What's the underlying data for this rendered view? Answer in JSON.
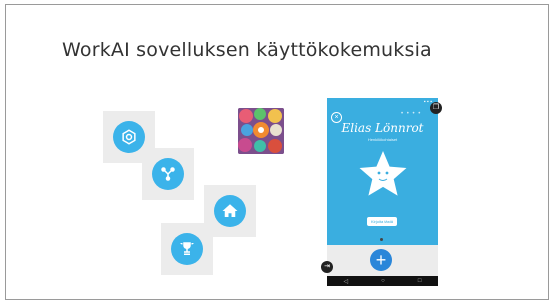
{
  "slide": {
    "title": "WorkAI sovelluksen käyttökokemuksia"
  },
  "icons": [
    {
      "name": "settings-icon",
      "color": "#3bb3ea"
    },
    {
      "name": "network-icon",
      "color": "#3bb3ea"
    },
    {
      "name": "home-icon",
      "color": "#3bb3ea"
    },
    {
      "name": "trophy-icon",
      "color": "#3bb3ea"
    }
  ],
  "phone": {
    "name": "Elias Lönnrot",
    "role": "Henkilökohtaiset",
    "pill_label": "Kirjoita tästä",
    "close_glyph": "×",
    "pager": "• • • •",
    "fab_glyph": "+",
    "nav": [
      "◁",
      "○",
      "□"
    ],
    "accent": "#3aaee0"
  }
}
